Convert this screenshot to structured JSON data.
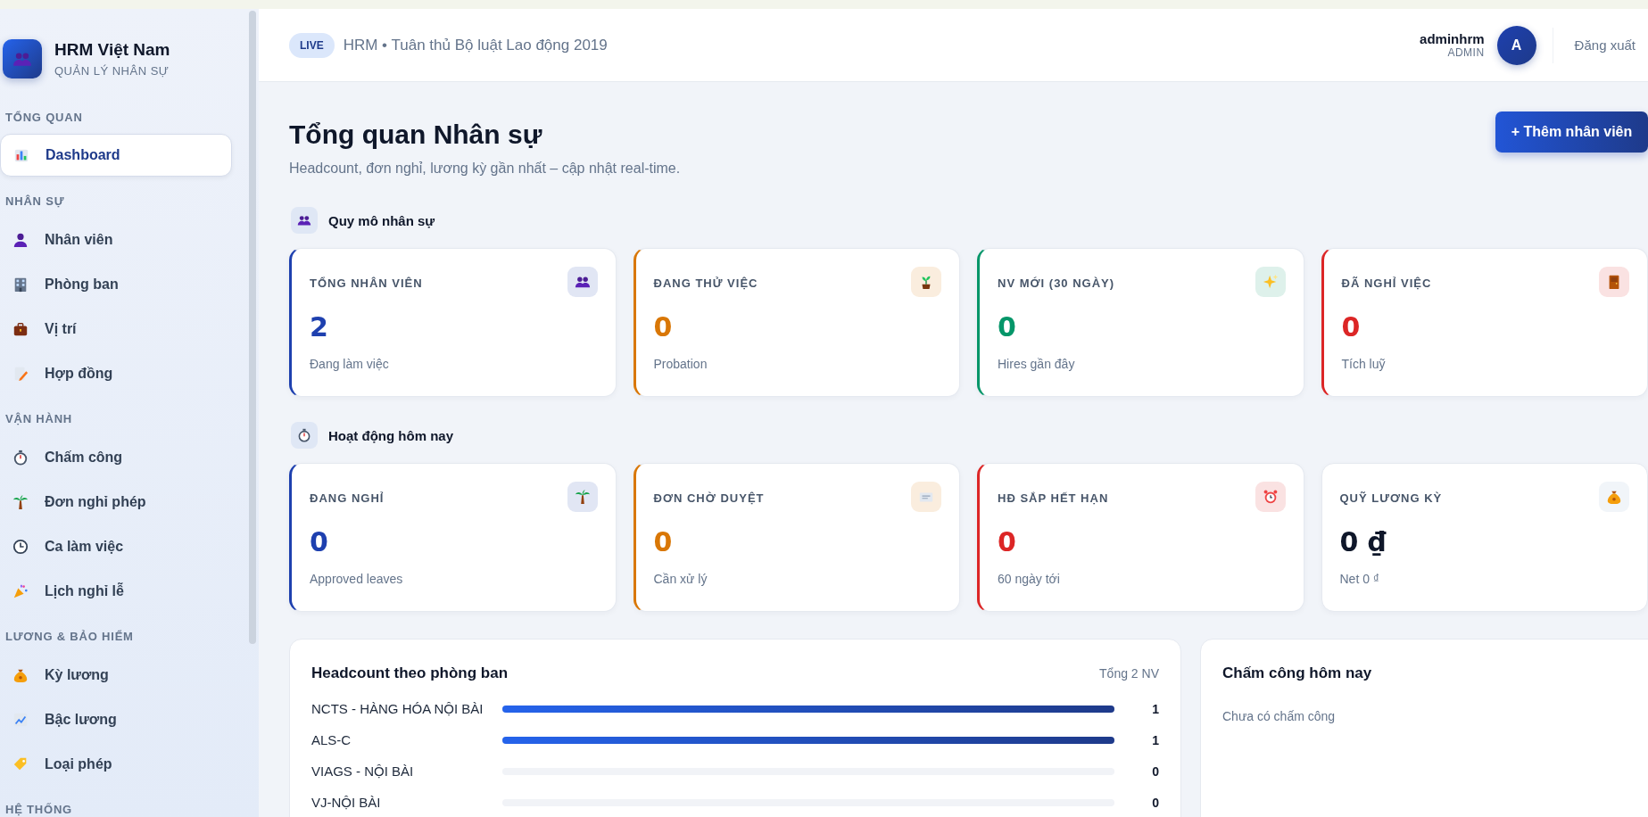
{
  "top_bar": {
    "badge": "LIVE",
    "title": "HRM • Tuân thủ Bộ luật Lao động 2019",
    "user": {
      "name": "adminhrm",
      "role": "ADMIN",
      "avatar": "A"
    },
    "logout": "Đăng xuất"
  },
  "sidebar": {
    "brand": {
      "name": "HRM Việt Nam",
      "subtitle": "QUẢN LÝ NHÂN SỰ"
    },
    "groups": [
      {
        "title": "TỔNG QUAN",
        "items": [
          {
            "label": "Dashboard",
            "selected": true
          }
        ]
      },
      {
        "title": "NHÂN SỰ",
        "items": [
          {
            "label": "Nhân viên",
            "selected": false
          },
          {
            "label": "Phòng ban",
            "selected": false
          },
          {
            "label": "Vị trí",
            "selected": false
          },
          {
            "label": "Hợp đồng",
            "selected": false
          }
        ]
      },
      {
        "title": "VẬN HÀNH",
        "items": [
          {
            "label": "Chấm công",
            "selected": false
          },
          {
            "label": "Đơn nghỉ phép",
            "selected": false
          },
          {
            "label": "Ca làm việc",
            "selected": false
          },
          {
            "label": "Lịch nghỉ lễ",
            "selected": false
          }
        ]
      },
      {
        "title": "LƯƠNG & BẢO HIỂM",
        "items": [
          {
            "label": "Kỳ lương",
            "selected": false
          },
          {
            "label": "Bậc lương",
            "selected": false
          },
          {
            "label": "Loại phép",
            "selected": false
          }
        ]
      },
      {
        "title": "HỆ THỐNG"
      }
    ]
  },
  "page": {
    "title": "Tổng quan Nhân sự",
    "subtitle": "Headcount, đơn nghỉ, lương kỳ gần nhất – cập nhật real-time.",
    "add_button": "+ Thêm nhân viên"
  },
  "sections": [
    {
      "title": "Quy mô nhân sự",
      "cards": [
        {
          "label": "TỔNG NHÂN VIÊN",
          "value": "2",
          "sub": "Đang làm việc",
          "color": "#1e40af",
          "accent": true
        },
        {
          "label": "ĐANG THỬ VIỆC",
          "value": "0",
          "sub": "Probation",
          "color": "#d97706",
          "accent": true
        },
        {
          "label": "NV MỚI (30 NGÀY)",
          "value": "0",
          "sub": "Hires gần đây",
          "color": "#059669",
          "accent": true
        },
        {
          "label": "ĐÃ NGHỈ VIỆC",
          "value": "0",
          "sub": "Tích luỹ",
          "color": "#dc2626",
          "accent": true
        }
      ]
    },
    {
      "title": "Hoạt động hôm nay",
      "cards": [
        {
          "label": "ĐANG NGHỈ",
          "value": "0",
          "sub": "Approved leaves",
          "color": "#1e40af",
          "accent": true
        },
        {
          "label": "ĐƠN CHỜ DUYỆT",
          "value": "0",
          "sub": "Cần xử lý",
          "color": "#d97706",
          "accent": true
        },
        {
          "label": "HĐ SẮP HẾT HẠN",
          "value": "0",
          "sub": "60 ngày tới",
          "color": "#dc2626",
          "accent": true
        },
        {
          "label": "QUỸ LƯƠNG KỲ",
          "value": "0 ₫",
          "sub": "Net 0 ₫",
          "color": "#0f172a",
          "accent": false
        }
      ]
    }
  ],
  "headcount_panel": {
    "title": "Headcount theo phòng ban",
    "total": "Tổng 2 NV",
    "rows": [
      {
        "name": "NCTS - HÀNG HÓA NỘI BÀI",
        "value": "1",
        "level": 1
      },
      {
        "name": "ALS-C",
        "value": "1",
        "level": 1
      },
      {
        "name": "VIAGS - NỘI BÀI",
        "value": "0",
        "level": 0
      },
      {
        "name": "VJ-NỘI BÀI",
        "value": "0",
        "level": 0
      }
    ]
  },
  "attendance_panel": {
    "title": "Chấm công hôm nay",
    "empty_text": "Chưa có chấm công"
  }
}
